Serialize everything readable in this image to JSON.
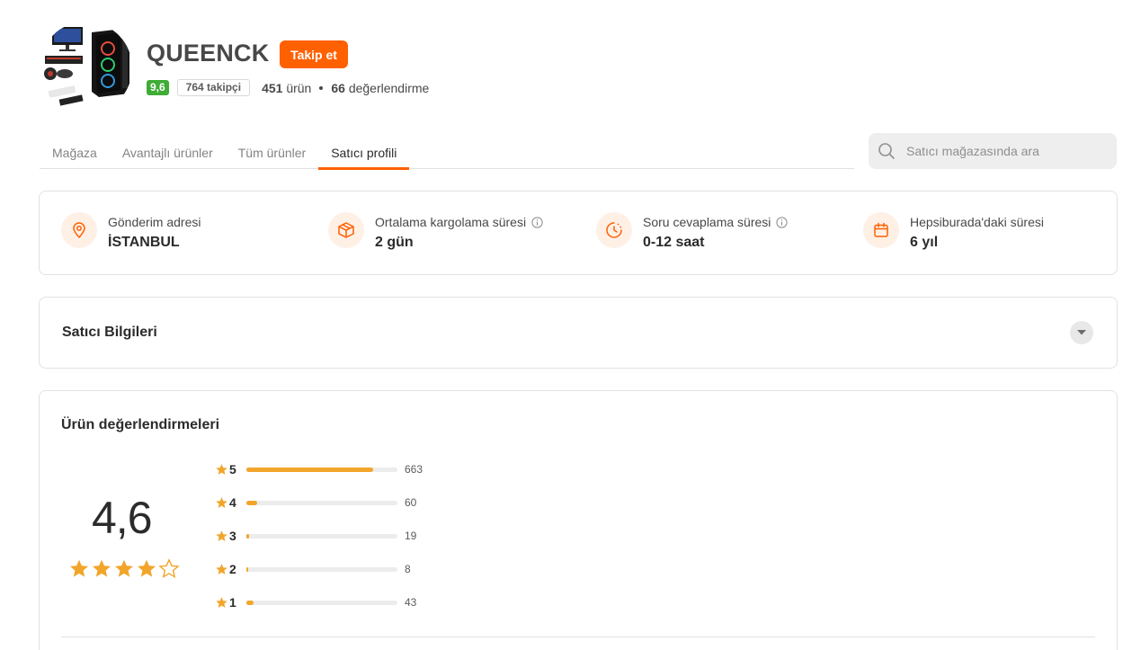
{
  "store": {
    "name": "QUEENCK",
    "follow_label": "Takip et",
    "rating": "9,6",
    "followers": "764 takipçi",
    "products_count": "451",
    "products_label": "ürün",
    "reviews_count": "66",
    "reviews_label": "değerlendirme"
  },
  "tabs": [
    {
      "label": "Mağaza",
      "active": false
    },
    {
      "label": "Avantajlı ürünler",
      "active": false
    },
    {
      "label": "Tüm ürünler",
      "active": false
    },
    {
      "label": "Satıcı profili",
      "active": true
    }
  ],
  "search": {
    "placeholder": "Satıcı mağazasında ara",
    "value": ""
  },
  "info": [
    {
      "icon": "location-pin-icon",
      "label": "Gönderim adresi",
      "value": "İSTANBUL",
      "has_info": false
    },
    {
      "icon": "package-icon",
      "label": "Ortalama kargolama süresi",
      "value": "2 gün",
      "has_info": true
    },
    {
      "icon": "clock-icon",
      "label": "Soru cevaplama süresi",
      "value": "0-12 saat",
      "has_info": true
    },
    {
      "icon": "calendar-icon",
      "label": "Hepsiburada'daki süresi",
      "value": "6 yıl",
      "has_info": false
    }
  ],
  "seller_info": {
    "title": "Satıcı Bilgileri"
  },
  "reviews": {
    "title": "Ürün değerlendirmeleri",
    "average": "4,6",
    "average_value": 4.6,
    "distribution": [
      {
        "star": "5",
        "count": "663",
        "fraction": 0.84
      },
      {
        "star": "4",
        "count": "60",
        "fraction": 0.07
      },
      {
        "star": "3",
        "count": "19",
        "fraction": 0.02
      },
      {
        "star": "2",
        "count": "8",
        "fraction": 0.01
      },
      {
        "star": "1",
        "count": "43",
        "fraction": 0.05
      }
    ]
  },
  "colors": {
    "brand": "#ff6000",
    "star": "#f2a52b",
    "rating_badge": "#3fac35",
    "icon_bg": "#fff0e6"
  }
}
